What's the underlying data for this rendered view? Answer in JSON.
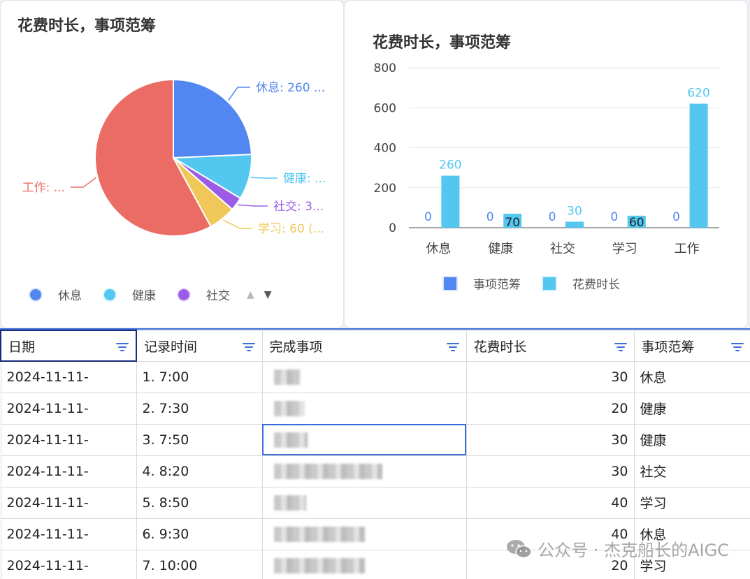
{
  "pie_card": {
    "title": "花费时长，事项范筹",
    "labels": {
      "rest": "休息: 260 ...",
      "health": "健康: ...",
      "social": "社交: 3...",
      "study": "学习: 60 (...",
      "work": "工作: ..."
    },
    "legend": [
      "休息",
      "健康",
      "社交"
    ]
  },
  "bar_card": {
    "title": "花费时长，事项范筹",
    "legend": [
      "事项范筹",
      "花费时长"
    ]
  },
  "colors": {
    "rest": "#5286f0",
    "health": "#53c7f0",
    "social": "#9c5de6",
    "study": "#f0c85a",
    "work": "#eb6c64",
    "bar_series1": "#5286f0",
    "bar_series2": "#53c7f0",
    "accent": "#3b6ed8"
  },
  "chart_data": [
    {
      "type": "pie",
      "title": "花费时长，事项范筹",
      "categories": [
        "休息",
        "健康",
        "社交",
        "学习",
        "工作"
      ],
      "values": [
        260,
        100,
        30,
        60,
        620
      ],
      "legend_visible": [
        "休息",
        "健康",
        "社交"
      ],
      "legend_position": "bottom"
    },
    {
      "type": "bar",
      "title": "花费时长，事项范筹",
      "categories": [
        "休息",
        "健康",
        "社交",
        "学习",
        "工作"
      ],
      "series": [
        {
          "name": "事项范筹",
          "values": [
            0,
            0,
            0,
            0,
            0
          ]
        },
        {
          "name": "花费时长",
          "values": [
            260,
            70,
            30,
            60,
            620
          ]
        }
      ],
      "ylim": [
        0,
        800
      ],
      "yticks": [
        0,
        200,
        400,
        600,
        800
      ],
      "grid": true,
      "legend_position": "bottom"
    }
  ],
  "table": {
    "headers": [
      "日期",
      "记录时间",
      "完成事项",
      "花费时长",
      "事项范筹"
    ],
    "rows": [
      {
        "date": "2024-11-11-",
        "time": "1. 7:00",
        "task": "",
        "duration": "30",
        "category": "休息"
      },
      {
        "date": "2024-11-11-",
        "time": "2. 7:30",
        "task": "",
        "duration": "20",
        "category": "健康"
      },
      {
        "date": "2024-11-11-",
        "time": "3. 7:50",
        "task": "",
        "duration": "30",
        "category": "健康"
      },
      {
        "date": "2024-11-11-",
        "time": "4. 8:20",
        "task": "",
        "duration": "30",
        "category": "社交"
      },
      {
        "date": "2024-11-11-",
        "time": "5. 8:50",
        "task": "",
        "duration": "40",
        "category": "学习"
      },
      {
        "date": "2024-11-11-",
        "time": "6. 9:30",
        "task": "",
        "duration": "40",
        "category": "休息"
      },
      {
        "date": "2024-11-11-",
        "time": "7. 10:00",
        "task": "",
        "duration": "20",
        "category": "学习"
      }
    ]
  },
  "watermark": "公众号 · 杰克船长的AIGC"
}
